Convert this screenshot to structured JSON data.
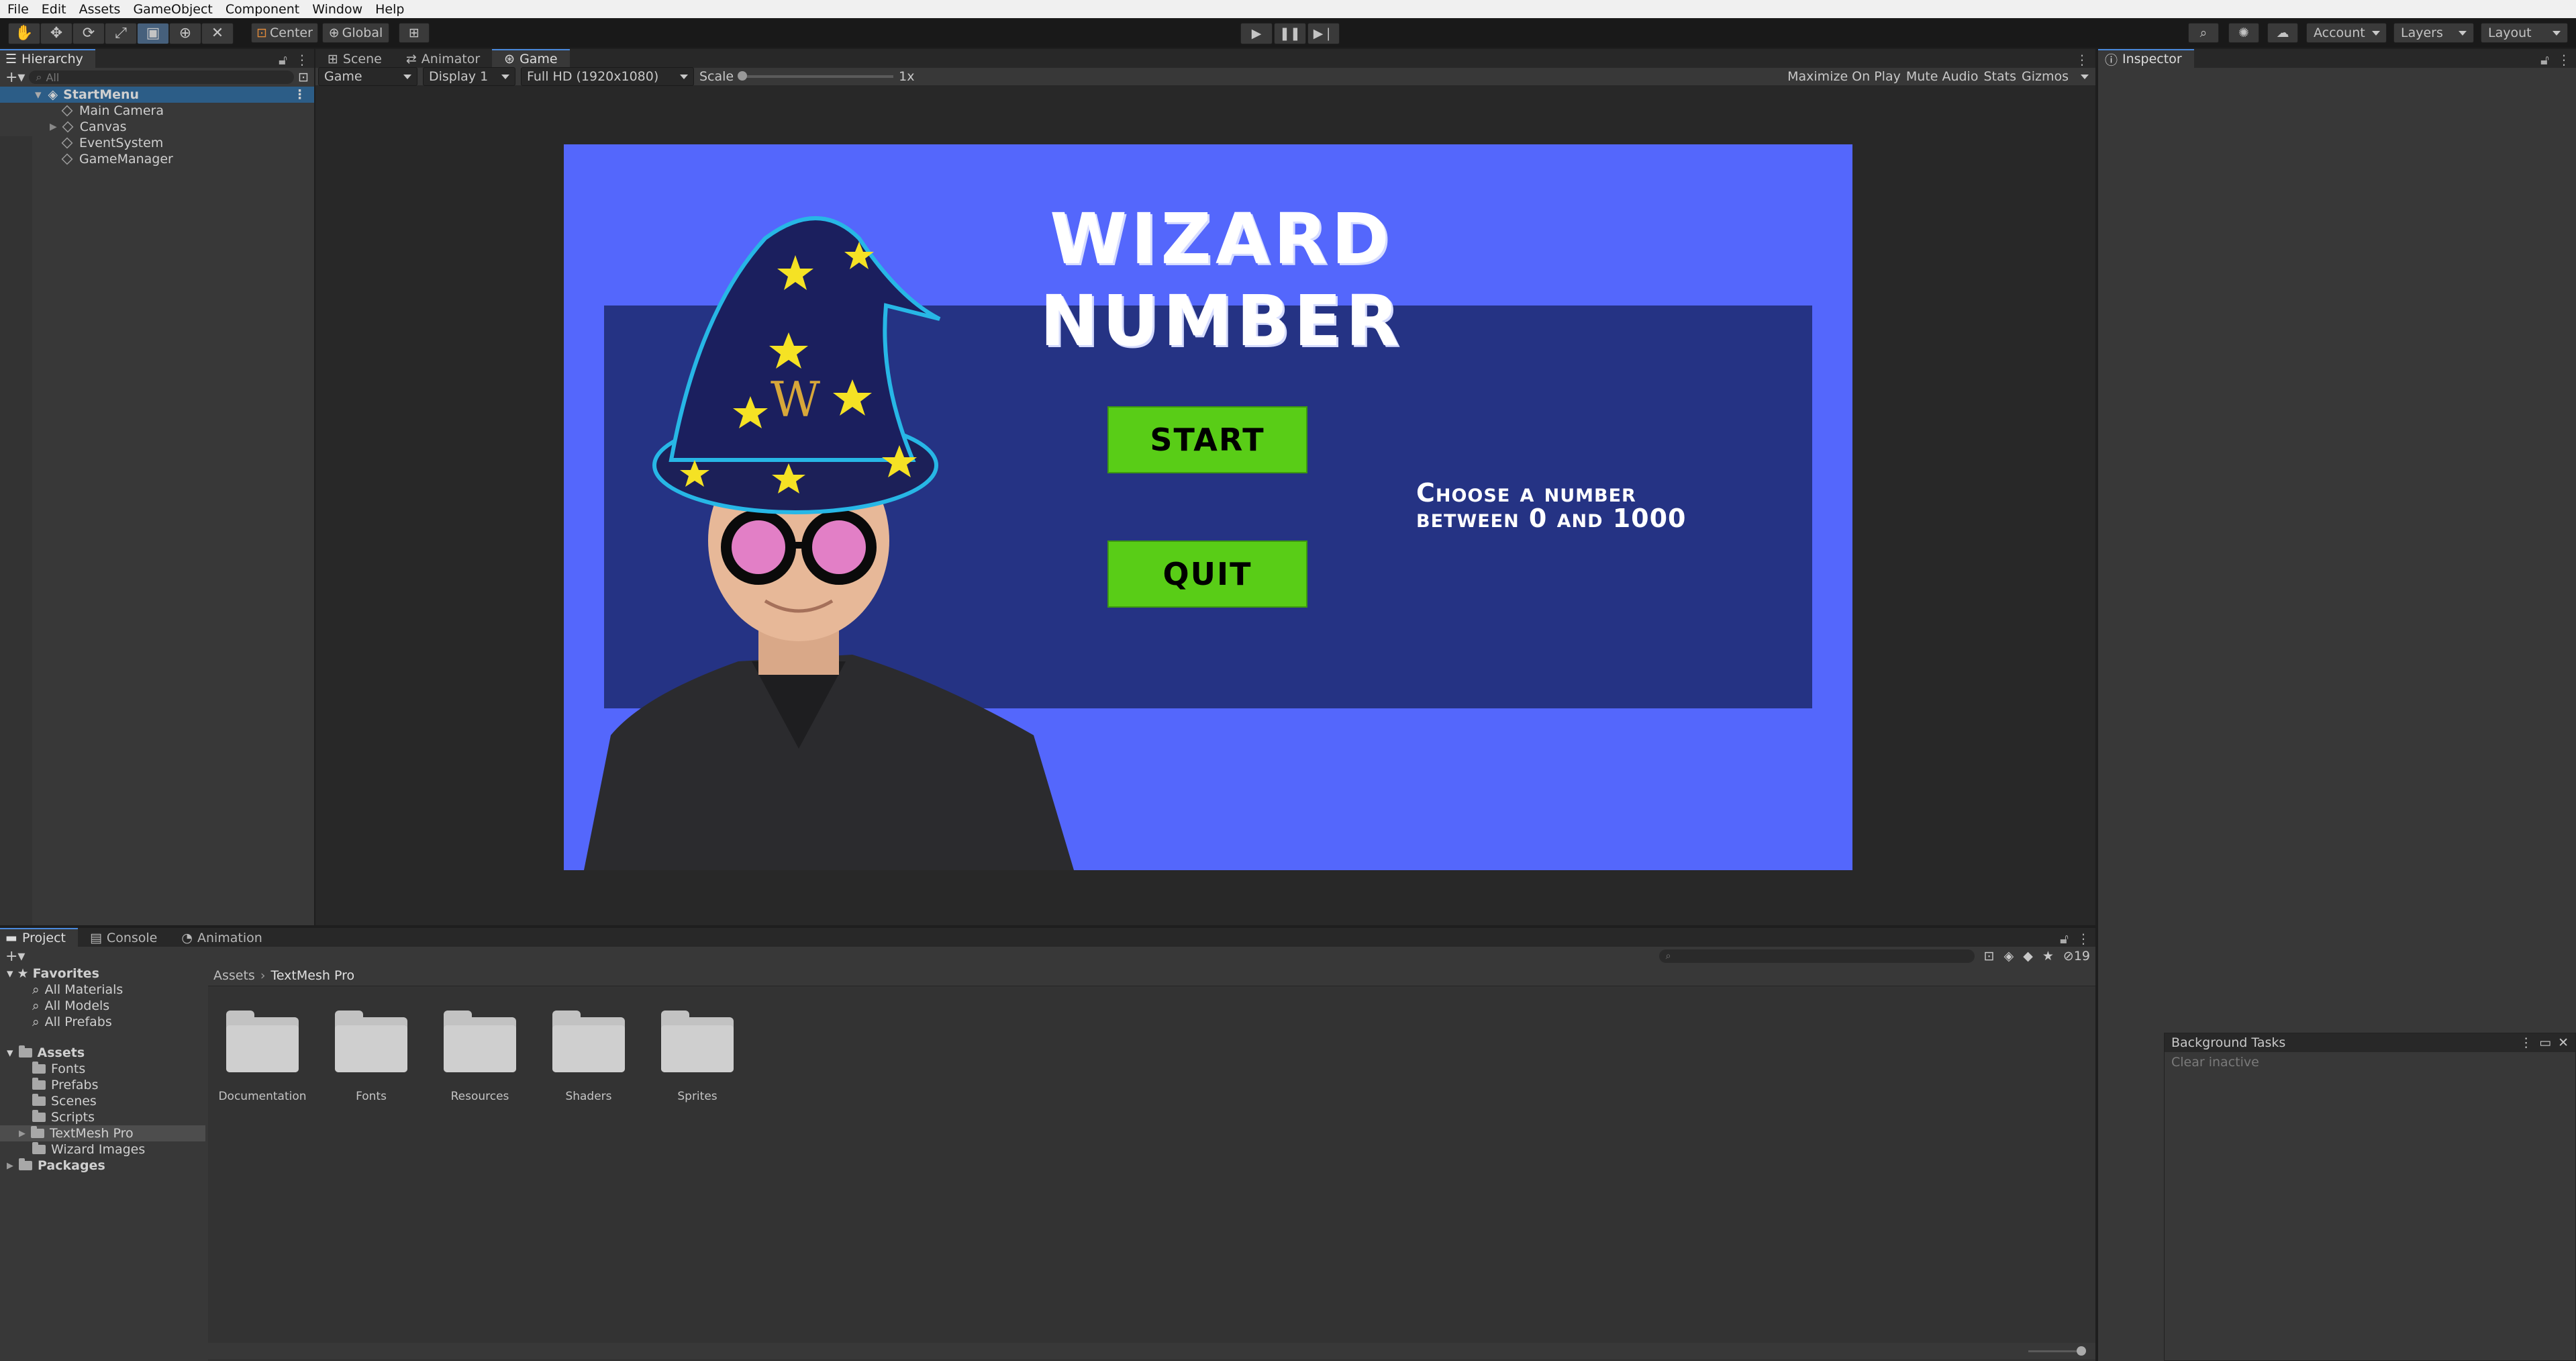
{
  "menu": [
    "File",
    "Edit",
    "Assets",
    "GameObject",
    "Component",
    "Window",
    "Help"
  ],
  "toolbar": {
    "pivot": "Center",
    "space": "Global",
    "account": "Account",
    "layers": "Layers",
    "layout": "Layout"
  },
  "hierarchy": {
    "tab": "Hierarchy",
    "search_placeholder": "All",
    "scene": "StartMenu",
    "items": [
      "Main Camera",
      "Canvas",
      "EventSystem",
      "GameManager"
    ]
  },
  "view_tabs": [
    "Scene",
    "Animator",
    "Game"
  ],
  "game_toolbar": {
    "mode": "Game",
    "display": "Display 1",
    "resolution": "Full HD (1920x1080)",
    "scale_label": "Scale",
    "scale_value": "1x",
    "maximize": "Maximize On Play",
    "mute": "Mute Audio",
    "stats": "Stats",
    "gizmos": "Gizmos"
  },
  "game": {
    "title": "WIZARD NUMBER",
    "start": "START",
    "quit": "QUIT",
    "prompt_line1": "Choose a number",
    "prompt_line2": "between 0 and 1000",
    "hat_letter": "W"
  },
  "inspector": {
    "tab": "Inspector"
  },
  "bottom_tabs": [
    "Project",
    "Console",
    "Animation"
  ],
  "project": {
    "favorites_label": "Favorites",
    "favorites": [
      "All Materials",
      "All Models",
      "All Prefabs"
    ],
    "assets_label": "Assets",
    "assets": [
      "Fonts",
      "Prefabs",
      "Scenes",
      "Scripts",
      "TextMesh Pro",
      "Wizard Images"
    ],
    "packages_label": "Packages",
    "breadcrumb": [
      "Assets",
      "TextMesh Pro"
    ],
    "folders": [
      "Documentation",
      "Fonts",
      "Resources",
      "Shaders",
      "Sprites"
    ],
    "hidden_count": "19"
  },
  "background_tasks": {
    "title": "Background Tasks",
    "clear": "Clear inactive"
  },
  "colors": {
    "game_bg": "#5467fc",
    "game_panel": "#253384",
    "button_green": "#59cd17",
    "selection_blue": "#2c5d87"
  }
}
